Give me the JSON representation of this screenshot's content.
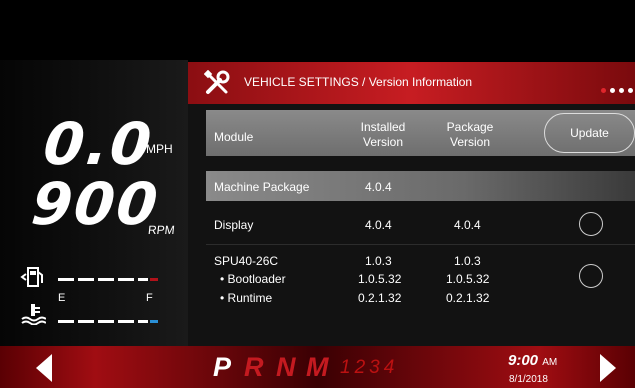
{
  "gauges": {
    "speed_value": "0.0",
    "speed_unit": "MPH",
    "rpm_value": "900",
    "rpm_unit": "RPM",
    "fuel_empty_label": "E",
    "fuel_full_label": "F",
    "fuel_icon": "fuel-pump-icon",
    "coolant_icon": "coolant-temp-icon"
  },
  "panel": {
    "title": "VEHICLE SETTINGS / Version Information",
    "icon": "wrench-screwdriver-icon",
    "columns": [
      "Module",
      "Installed Version",
      "Package Version"
    ],
    "columns_html": {
      "installed_1": "Installed",
      "installed_2": "Version",
      "package_1": "Package",
      "package_2": "Version"
    },
    "update_label": "Update",
    "machine_package": {
      "label": "Machine Package",
      "installed": "4.0.4"
    },
    "display": {
      "label": "Display",
      "installed": "4.0.4",
      "package": "4.0.4"
    },
    "spu": {
      "label": "SPU40-26C",
      "installed": "1.0.3",
      "package": "1.0.3",
      "bootloader_label": "• Bootloader",
      "bootloader_installed": "1.0.5.32",
      "bootloader_package": "1.0.5.32",
      "runtime_label": "• Runtime",
      "runtime_installed": "0.2.1.32",
      "runtime_package": "0.2.1.32"
    }
  },
  "bottom": {
    "gears": [
      "P",
      "R",
      "N",
      "M"
    ],
    "gear_numbers": "1234",
    "time": "9:00",
    "ampm": "AM",
    "date": "8/1/2018"
  },
  "colors": {
    "accent_red": "#c71d22",
    "active_white": "#ffffff",
    "coolant_blue": "#2a8fd6"
  }
}
